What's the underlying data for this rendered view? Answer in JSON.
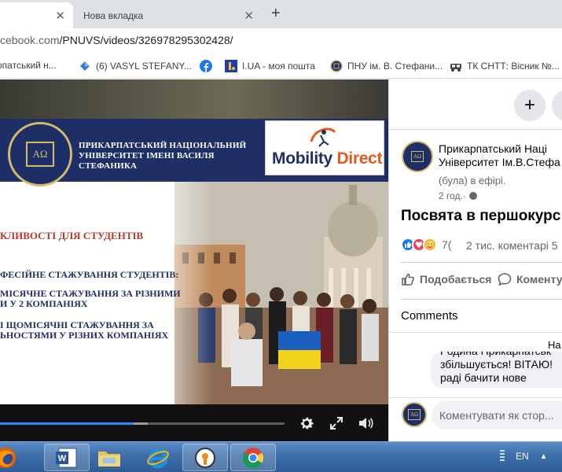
{
  "browser": {
    "tabs": [
      {
        "label": "",
        "active": true
      },
      {
        "label": "Нова вкладка",
        "active": false
      }
    ],
    "new_tab_label": "+",
    "close_glyph": "✕",
    "url_host": "ebook.com",
    "url_path": "/PNUVS/videos/326978295302428/",
    "url_prefix": "c",
    "bookmarks": [
      {
        "label": "рпатський н...",
        "icon": "page-icon"
      },
      {
        "label": "(6) VASYL STEFANY...",
        "icon": "diamond-icon"
      },
      {
        "label": "",
        "icon": "facebook-icon"
      },
      {
        "label": "I.UA - моя пошта",
        "icon": "iua-icon"
      },
      {
        "label": "ПНУ ім. В. Стефани...",
        "icon": "pnu-icon"
      },
      {
        "label": "ТК СНТТ: Вісник №...",
        "icon": "tk-icon"
      }
    ]
  },
  "video": {
    "university_name": "ПРИКАРПАТСЬКИЙ НАЦІОНАЛЬНИЙ УНІВЕРСИТЕТ ІМЕНІ ВАСИЛЯ СТЕФАНИКА",
    "seal_letters": "ΑΩ",
    "brand_mobility": "Mobility",
    "brand_direct": "Direct",
    "heading": "КЛИВОСТІ ДЛЯ СТУДЕНТІВ",
    "line1": "ФЕСІЙНЕ СТАЖУВАННЯ СТУДЕНТІВ:",
    "line2a": "МІСЯЧНЕ СТАЖУВАННЯ ЗА РІЗНИМИ",
    "line2b": "И У 2 КОМПАНІЯХ",
    "line3a": "І ЩОМІСЯЧНІ СТАЖУВАННЯ ЗА",
    "line3b": "ЬНОСТЯМИ У РІЗНИХ КОМПАНІЯХ",
    "progress_played": 0.47,
    "progress_buffered": 0.52
  },
  "panel": {
    "plus_label": "+",
    "page_name_line1": "Прикарпатський Наці",
    "page_name_line2": "Університет Ім.В.Стефа",
    "live_note": "(була) в ефірі.",
    "post_time": "2 год.",
    "post_title": "Посвята в першокурс",
    "reaction_count": "7(",
    "comment_count": "2 тис. коментарі  5",
    "like_action": "Подобається",
    "comment_action": "Коменту",
    "comments_heading": "Comments",
    "comment_author_tail": "На",
    "comment_text": "Родина Прикарпатськ збільшується! ВІТАЮ! раді бачити нове",
    "compose_placeholder": "Коментувати як стор..."
  },
  "taskbar": {
    "language": "EN",
    "tray_arrow": "▲",
    "apps": [
      "firefox-icon",
      "word-icon",
      "explorer-icon",
      "ie-icon",
      "vpn-icon",
      "chrome-icon"
    ]
  },
  "colors": {
    "facebook_blue": "#1877f2",
    "slide_navy": "#1d2f66",
    "slide_gold": "#d5b86a",
    "brand_orange": "#e65a1d",
    "progress_blue": "#2d88ff"
  }
}
